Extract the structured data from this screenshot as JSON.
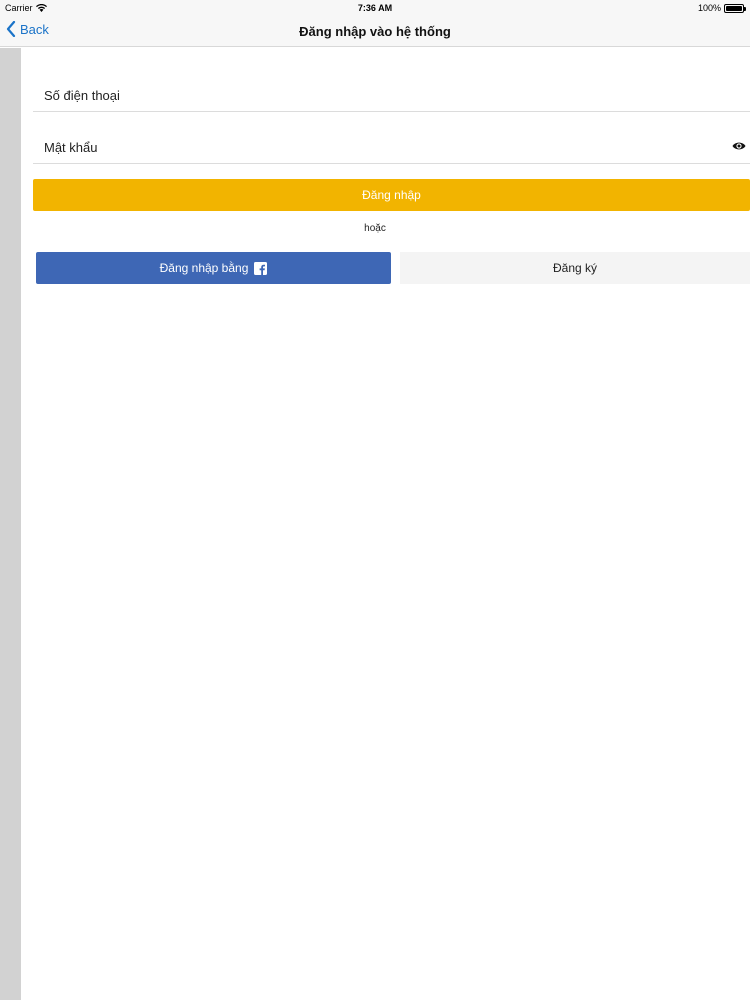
{
  "status_bar": {
    "carrier": "Carrier",
    "time": "7:36 AM",
    "battery": "100%"
  },
  "nav": {
    "back_label": "Back",
    "title": "Đăng nhập vào hệ thống"
  },
  "form": {
    "phone_placeholder": "Số điện thoại",
    "phone_value": "",
    "password_placeholder": "Mật khẩu",
    "password_value": "",
    "login_label": "Đăng nhập",
    "or_text": "hoặc",
    "facebook_label": "Đăng nhập bằng",
    "register_label": "Đăng ký"
  },
  "colors": {
    "accent_yellow": "#f2b400",
    "facebook_blue": "#3e67b5",
    "link_blue": "#1a73c8"
  },
  "icons": [
    "wifi-icon",
    "battery-icon",
    "chevron-left-icon",
    "eye-icon",
    "facebook-icon"
  ]
}
